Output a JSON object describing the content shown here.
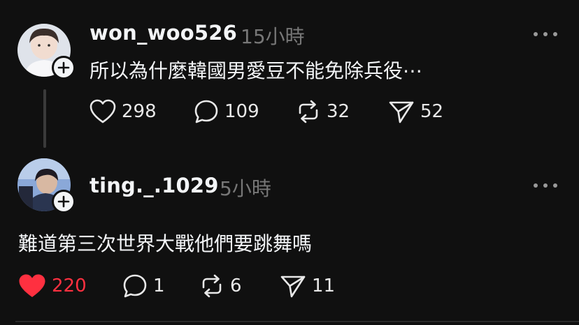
{
  "posts": [
    {
      "username": "won_woo526",
      "time": "15小時",
      "content": "所以為什麼韓國男愛豆不能免除兵役⋯",
      "likes": "298",
      "replies": "109",
      "reposts": "32",
      "shares": "52",
      "liked": false
    },
    {
      "username": "ting._.1029",
      "time": "5小時",
      "content": "難道第三次世界大戰他們要跳舞嗎",
      "likes": "220",
      "replies": "1",
      "reposts": "6",
      "shares": "11",
      "liked": true
    }
  ],
  "colors": {
    "background": "#101010",
    "text": "#f3f5f7",
    "muted": "#777777",
    "like_active": "#ff3040"
  },
  "icons": {
    "like": "heart-icon",
    "reply": "speech-bubble-icon",
    "repost": "repost-arrows-icon",
    "share": "paper-plane-icon",
    "more": "more-dots-icon",
    "follow": "plus-icon"
  }
}
